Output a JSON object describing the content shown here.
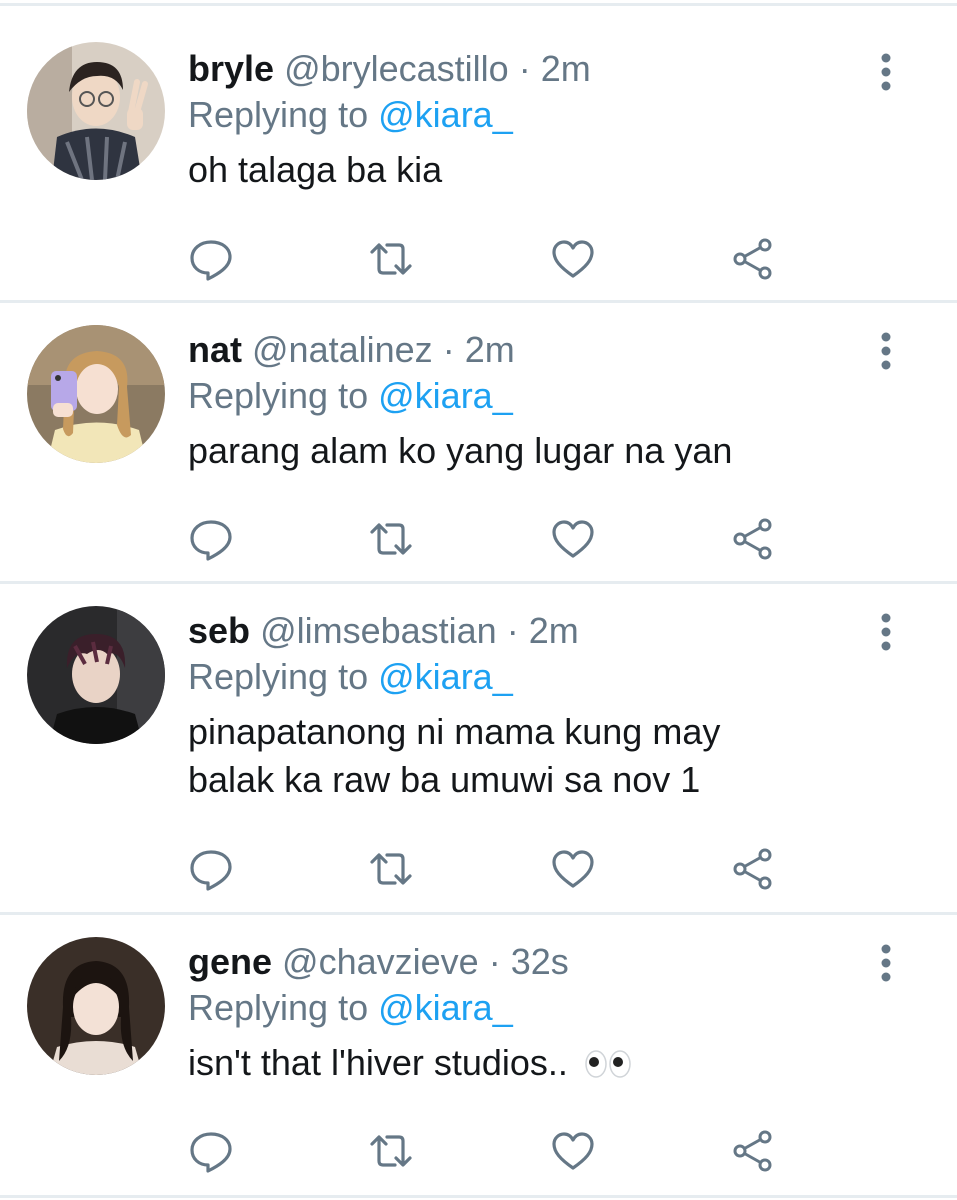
{
  "tweets": [
    {
      "display_name": "bryle",
      "handle": "@brylecastillo",
      "sep": "·",
      "time": "2m",
      "replying_prefix": "Replying to",
      "replying_to": "@kiara_",
      "text": "oh talaga ba kia"
    },
    {
      "display_name": "nat",
      "handle": "@natalinez",
      "sep": "·",
      "time": "2m",
      "replying_prefix": "Replying to",
      "replying_to": "@kiara_",
      "text": "parang alam ko yang lugar na yan"
    },
    {
      "display_name": "seb",
      "handle": "@limsebastian",
      "sep": "·",
      "time": "2m",
      "replying_prefix": "Replying to",
      "replying_to": "@kiara_",
      "text_line1": "pinapatanong ni mama kung may",
      "text_line2": "balak ka raw ba umuwi sa nov 1"
    },
    {
      "display_name": "gene",
      "handle": "@chavzieve",
      "sep": "·",
      "time": "32s",
      "replying_prefix": "Replying to",
      "replying_to": "@kiara_",
      "text": "isn't that l'hiver studios.."
    }
  ],
  "icons": {
    "reply": "reply-icon",
    "retweet": "retweet-icon",
    "like": "heart-icon",
    "share": "share-icon",
    "more": "more-vertical-icon",
    "emoji": "eyes-emoji"
  },
  "colors": {
    "text": "#14171a",
    "secondary": "#657786",
    "mention": "#1da1f2",
    "icon": "#657786",
    "separator": "#e6ecf0"
  }
}
